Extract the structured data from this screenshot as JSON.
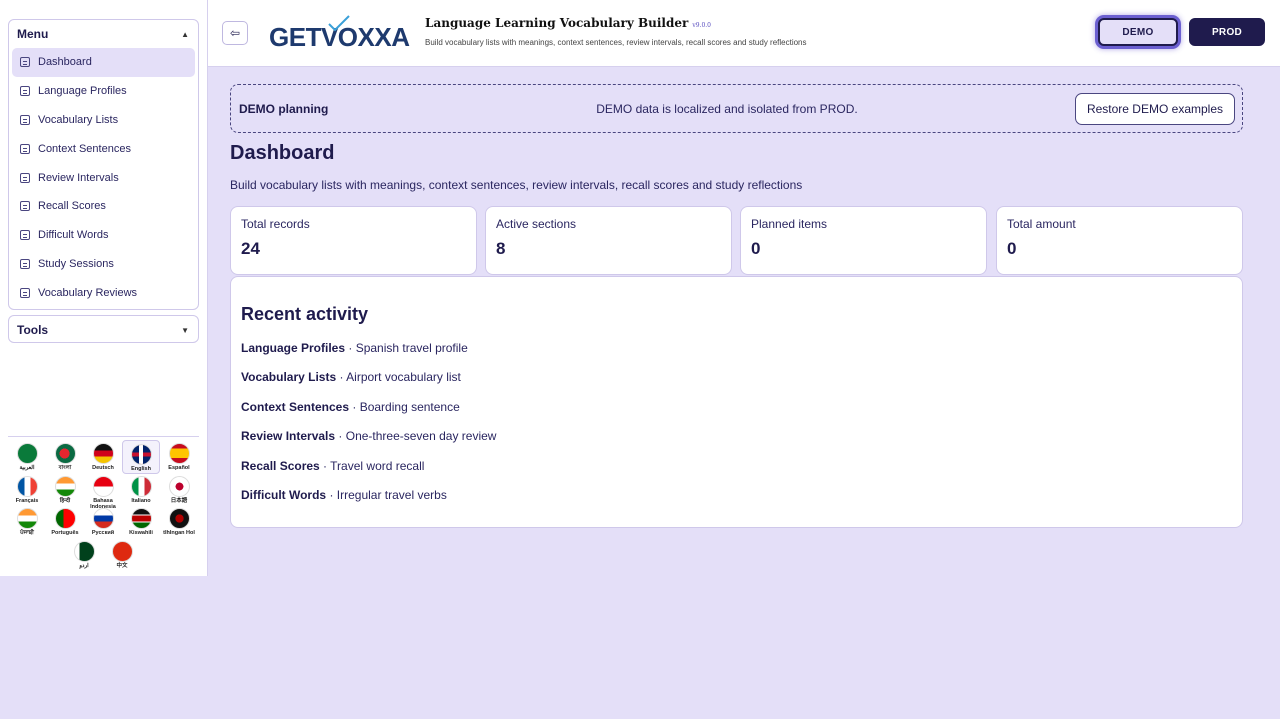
{
  "sidebar": {
    "menu_title": "Menu",
    "tools_title": "Tools",
    "items": [
      {
        "label": "Dashboard",
        "active": true
      },
      {
        "label": "Language Profiles"
      },
      {
        "label": "Vocabulary Lists"
      },
      {
        "label": "Context Sentences"
      },
      {
        "label": "Review Intervals"
      },
      {
        "label": "Recall Scores"
      },
      {
        "label": "Difficult Words"
      },
      {
        "label": "Study Sessions"
      },
      {
        "label": "Vocabulary Reviews"
      }
    ],
    "languages": [
      {
        "name": "العربية",
        "icon": "saudi-flag-icon"
      },
      {
        "name": "বাংলা",
        "icon": "bangladesh-flag-icon"
      },
      {
        "name": "Deutsch",
        "icon": "germany-flag-icon"
      },
      {
        "name": "English",
        "icon": "uk-flag-icon",
        "selected": true
      },
      {
        "name": "Español",
        "icon": "spain-flag-icon"
      },
      {
        "name": "Français",
        "icon": "france-flag-icon"
      },
      {
        "name": "हिन्दी",
        "icon": "india-flag-icon"
      },
      {
        "name": "Bahasa Indonesia",
        "icon": "indonesia-flag-icon"
      },
      {
        "name": "Italiano",
        "icon": "italy-flag-icon"
      },
      {
        "name": "日本語",
        "icon": "japan-flag-icon"
      },
      {
        "name": "ਪੰਜਾਬੀ",
        "icon": "india-flag-icon"
      },
      {
        "name": "Português",
        "icon": "portugal-flag-icon"
      },
      {
        "name": "Русский",
        "icon": "russia-flag-icon"
      },
      {
        "name": "Kiswahili",
        "icon": "kenya-flag-icon"
      },
      {
        "name": "tlhIngan Hol",
        "icon": "klingon-flag-icon"
      },
      {
        "name": "اردو",
        "icon": "pakistan-flag-icon"
      },
      {
        "name": "中文",
        "icon": "china-flag-icon"
      }
    ]
  },
  "header": {
    "logo_text_a": "GET",
    "logo_text_b": "OXXA",
    "title": "Language Learning Vocabulary Builder",
    "version": "v9.0.0",
    "subtitle": "Build vocabulary lists with meanings, context sentences, review intervals, recall scores and study reflections",
    "demo_label": "DEMO",
    "prod_label": "PROD"
  },
  "banner": {
    "label": "DEMO planning",
    "message": "DEMO data is localized and isolated from PROD.",
    "restore_label": "Restore DEMO examples"
  },
  "page": {
    "title": "Dashboard",
    "subtitle": "Build vocabulary lists with meanings, context sentences, review intervals, recall scores and study reflections"
  },
  "stats": [
    {
      "label": "Total records",
      "value": "24"
    },
    {
      "label": "Active sections",
      "value": "8"
    },
    {
      "label": "Planned items",
      "value": "0"
    },
    {
      "label": "Total amount",
      "value": "0"
    }
  ],
  "activity": {
    "title": "Recent activity",
    "rows": [
      {
        "section": "Language Profiles",
        "detail": "Spanish travel profile"
      },
      {
        "section": "Vocabulary Lists",
        "detail": "Airport vocabulary list"
      },
      {
        "section": "Context Sentences",
        "detail": "Boarding sentence"
      },
      {
        "section": "Review Intervals",
        "detail": "One-three-seven day review"
      },
      {
        "section": "Recall Scores",
        "detail": "Travel word recall"
      },
      {
        "section": "Difficult Words",
        "detail": "Irregular travel verbs"
      }
    ]
  },
  "colors": {
    "accent": "#1f1b4d",
    "background": "#e4dff8",
    "highlight": "#6b5fd0"
  }
}
